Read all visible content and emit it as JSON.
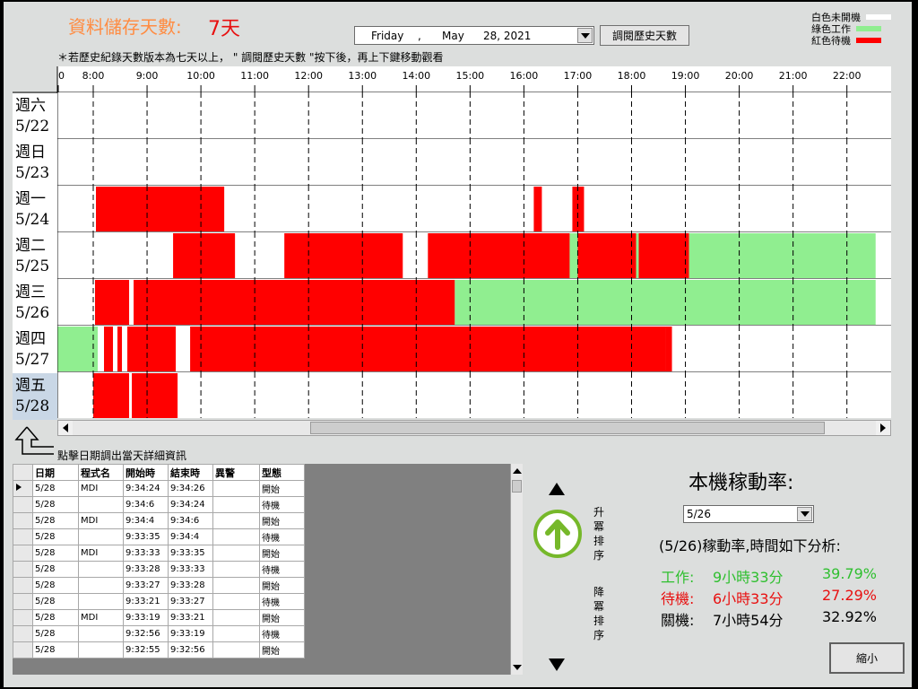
{
  "header": {
    "title_label": "資料儲存天數:",
    "title_value": "7天",
    "note": "＊若歷史紀錄天數版本為七天以上， \" 調閱歷史天數 \"按下後，再上下鍵移動觀看",
    "date_combo": {
      "weekday": "Friday",
      "sep": ",",
      "month": "May",
      "daynum": "28, 2021"
    },
    "history_button": "調閱歷史天數"
  },
  "legend": [
    {
      "label": "白色未開機",
      "color": "#ffffff"
    },
    {
      "label": "綠色工作",
      "color": "#90ee90"
    },
    {
      "label": "紅色待機",
      "color": "#ff0000"
    }
  ],
  "timeline": {
    "hour_labels": [
      "0",
      "8:00",
      "9:00",
      "10:00",
      "11:00",
      "12:00",
      "13:00",
      "14:00",
      "15:00",
      "16:00",
      "17:00",
      "18:00",
      "19:00",
      "20:00",
      "21:00",
      "22:00"
    ],
    "days": [
      {
        "weekday": "週六",
        "date": "5/22",
        "selected": false,
        "segments": []
      },
      {
        "weekday": "週日",
        "date": "5/23",
        "selected": false,
        "segments": []
      },
      {
        "weekday": "週一",
        "date": "5/24",
        "selected": false,
        "segments": [
          {
            "state": "standby",
            "start": "8:03",
            "end": "10:26"
          },
          {
            "state": "standby",
            "start": "16:11",
            "end": "16:20"
          },
          {
            "state": "standby",
            "start": "16:54",
            "end": "17:07"
          }
        ]
      },
      {
        "weekday": "週二",
        "date": "5/25",
        "selected": false,
        "segments": [
          {
            "state": "standby",
            "start": "9:29",
            "end": "10:38"
          },
          {
            "state": "standby",
            "start": "11:33",
            "end": "13:45"
          },
          {
            "state": "standby",
            "start": "14:13",
            "end": "16:51"
          },
          {
            "state": "work",
            "start": "16:51",
            "end": "17:00"
          },
          {
            "state": "standby",
            "start": "17:00",
            "end": "18:05"
          },
          {
            "state": "work",
            "start": "18:05",
            "end": "18:08"
          },
          {
            "state": "standby",
            "start": "18:08",
            "end": "19:04"
          },
          {
            "state": "work",
            "start": "19:04",
            "end": "22:32"
          }
        ]
      },
      {
        "weekday": "週三",
        "date": "5/26",
        "selected": false,
        "segments": [
          {
            "state": "standby",
            "start": "8:02",
            "end": "8:40"
          },
          {
            "state": "standby",
            "start": "8:45",
            "end": "14:43"
          },
          {
            "state": "work",
            "start": "14:43",
            "end": "22:32"
          }
        ]
      },
      {
        "weekday": "週四",
        "date": "5/27",
        "selected": false,
        "segments": [
          {
            "state": "work",
            "start": "7:00",
            "end": "8:05"
          },
          {
            "state": "standby",
            "start": "8:12",
            "end": "8:22"
          },
          {
            "state": "standby",
            "start": "8:27",
            "end": "8:32"
          },
          {
            "state": "standby",
            "start": "8:38",
            "end": "9:32"
          },
          {
            "state": "standby",
            "start": "9:48",
            "end": "18:38"
          },
          {
            "state": "standby",
            "start": "18:38",
            "end": "18:45"
          }
        ]
      },
      {
        "weekday": "週五",
        "date": "5/28",
        "selected": true,
        "segments": [
          {
            "state": "standby",
            "start": "8:00",
            "end": "8:40"
          },
          {
            "state": "standby",
            "start": "8:43",
            "end": "9:34"
          }
        ]
      }
    ]
  },
  "hint_text": "點擊日期調出當天詳細資訊",
  "log_table": {
    "headers": [
      "日期",
      "程式名",
      "開始時",
      "結束時",
      "異警",
      "型態"
    ],
    "rows": [
      [
        "5/28",
        "MDI",
        "9:34:24",
        "9:34:26",
        "",
        "開始"
      ],
      [
        "5/28",
        "",
        "9:34:6",
        "9:34:24",
        "",
        "待機"
      ],
      [
        "5/28",
        "MDI",
        "9:34:4",
        "9:34:6",
        "",
        "開始"
      ],
      [
        "5/28",
        "",
        "9:33:35",
        "9:34:4",
        "",
        "待機"
      ],
      [
        "5/28",
        "MDI",
        "9:33:33",
        "9:33:35",
        "",
        "開始"
      ],
      [
        "5/28",
        "",
        "9:33:28",
        "9:33:33",
        "",
        "待機"
      ],
      [
        "5/28",
        "",
        "9:33:27",
        "9:33:28",
        "",
        "開始"
      ],
      [
        "5/28",
        "",
        "9:33:21",
        "9:33:27",
        "",
        "待機"
      ],
      [
        "5/28",
        "MDI",
        "9:33:19",
        "9:33:21",
        "",
        "開始"
      ],
      [
        "5/28",
        "",
        "9:32:56",
        "9:33:19",
        "",
        "待機"
      ],
      [
        "5/28",
        "",
        "9:32:55",
        "9:32:56",
        "",
        "開始"
      ]
    ]
  },
  "sort": {
    "asc_label": "升冪排序",
    "desc_label": "降冪排序"
  },
  "utilization": {
    "title": "本機稼動率:",
    "selected_day": "5/26",
    "analysis_text": "(5/26)稼動率,時間如下分析:",
    "stats": [
      {
        "label": "工作:",
        "duration": "9小時33分",
        "percent": "39.79%",
        "color": "#2fbf2f"
      },
      {
        "label": "待機:",
        "duration": "6小時33分",
        "percent": "27.29%",
        "color": "#e81010"
      },
      {
        "label": "關機:",
        "duration": "7小時54分",
        "percent": "32.92%",
        "color": "#000000"
      }
    ]
  },
  "shrink_button": "縮小"
}
